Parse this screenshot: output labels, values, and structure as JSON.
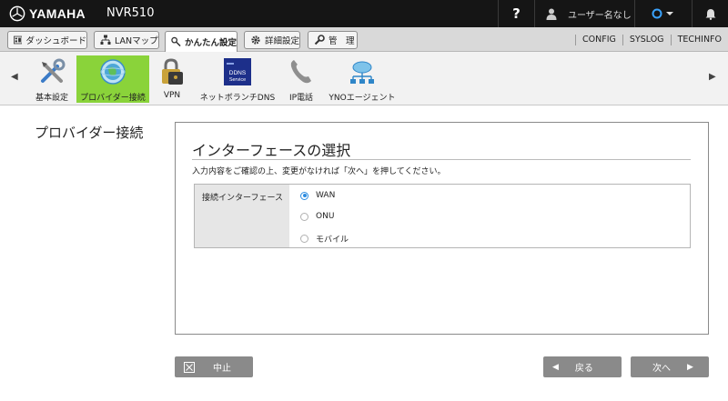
{
  "header": {
    "brand": "YAMAHA",
    "model": "NVR510",
    "help_label": "?",
    "user_label": "ユーザー名なし",
    "status_color": "#3aa3ff"
  },
  "tabs": [
    {
      "label": "ダッシュボード",
      "icon": "dashboard-icon",
      "active": false
    },
    {
      "label": "LANマップ",
      "icon": "lanmap-icon",
      "active": false
    },
    {
      "label": "かんたん設定",
      "icon": "wizard-icon",
      "active": true
    },
    {
      "label": "詳細設定",
      "icon": "gear-icon",
      "active": false
    },
    {
      "label": "管　理",
      "icon": "wrench-icon",
      "active": false
    }
  ],
  "top_links": [
    "CONFIG",
    "SYSLOG",
    "TECHINFO"
  ],
  "nav": {
    "items": [
      {
        "label": "基本設定",
        "icon": "tools-icon",
        "active": false
      },
      {
        "label": "プロバイダー接続",
        "icon": "globe-icon",
        "active": true
      },
      {
        "label": "VPN",
        "icon": "vpn-lock-icon",
        "active": false
      },
      {
        "label": "ネットボランチDNS",
        "icon": "ddns-service-icon",
        "active": false
      },
      {
        "label": "IP電話",
        "icon": "phone-icon",
        "active": false
      },
      {
        "label": "YNOエージェント",
        "icon": "yno-network-icon",
        "active": false
      }
    ],
    "ddns_icon_text": "DDNS\nService"
  },
  "main": {
    "page_title": "プロバイダー接続",
    "panel_title": "インターフェースの選択",
    "description": "入力内容をご確認の上、変更がなければ「次へ」を押してください。",
    "field_label": "接続インターフェース",
    "options": [
      {
        "label": "WAN",
        "checked": true
      },
      {
        "label": "ONU",
        "checked": false
      },
      {
        "label": "モバイル",
        "checked": false
      }
    ]
  },
  "buttons": {
    "cancel": "中止",
    "back": "戻る",
    "next": "次へ"
  },
  "colors": {
    "active_nav": "#8ad33a",
    "radio_checked": "#2b8be0",
    "button_bg": "#8a8a8a"
  }
}
